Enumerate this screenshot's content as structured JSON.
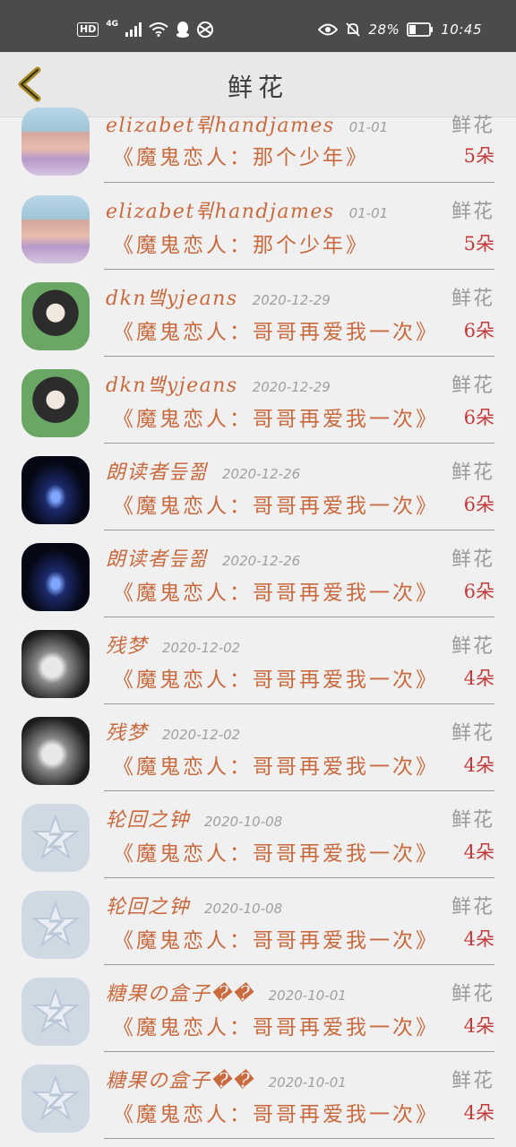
{
  "status_bar": {
    "hd": "HD",
    "network": "4G",
    "battery": "28%",
    "time": "10:45"
  },
  "header": {
    "title": "鲜花"
  },
  "rows": [
    {
      "name": "elizabet뤾handjames",
      "date": "01-01",
      "gift": "鲜花",
      "book": "《魔鬼恋人：那个少年》",
      "count": "5朵",
      "avatar": "boy"
    },
    {
      "name": "elizabet뤾handjames",
      "date": "01-01",
      "gift": "鲜花",
      "book": "《魔鬼恋人：那个少年》",
      "count": "5朵",
      "avatar": "boy"
    },
    {
      "name": "dkn뱈yjeans",
      "date": "2020-12-29",
      "gift": "鲜花",
      "book": "《魔鬼恋人：哥哥再爱我一次》",
      "count": "6朵",
      "avatar": "girl"
    },
    {
      "name": "dkn뱈yjeans",
      "date": "2020-12-29",
      "gift": "鲜花",
      "book": "《魔鬼恋人：哥哥再爱我一次》",
      "count": "6朵",
      "avatar": "girl"
    },
    {
      "name": "朗读者듶쬚",
      "date": "2020-12-26",
      "gift": "鲜花",
      "book": "《魔鬼恋人：哥哥再爱我一次》",
      "count": "6朵",
      "avatar": "tunnel"
    },
    {
      "name": "朗读者듶쬚",
      "date": "2020-12-26",
      "gift": "鲜花",
      "book": "《魔鬼恋人：哥哥再爱我一次》",
      "count": "6朵",
      "avatar": "tunnel"
    },
    {
      "name": "残梦",
      "date": "2020-12-02",
      "gift": "鲜花",
      "book": "《魔鬼恋人：哥哥再爱我一次》",
      "count": "4朵",
      "avatar": "sad"
    },
    {
      "name": "残梦",
      "date": "2020-12-02",
      "gift": "鲜花",
      "book": "《魔鬼恋人：哥哥再爱我一次》",
      "count": "4朵",
      "avatar": "sad"
    },
    {
      "name": "轮回之钟",
      "date": "2020-10-08",
      "gift": "鲜花",
      "book": "《魔鬼恋人：哥哥再爱我一次》",
      "count": "4朵",
      "avatar": "default"
    },
    {
      "name": "轮回之钟",
      "date": "2020-10-08",
      "gift": "鲜花",
      "book": "《魔鬼恋人：哥哥再爱我一次》",
      "count": "4朵",
      "avatar": "default"
    },
    {
      "name": "糖果の盒子��",
      "date": "2020-10-01",
      "gift": "鲜花",
      "book": "《魔鬼恋人：哥哥再爱我一次》",
      "count": "4朵",
      "avatar": "default"
    },
    {
      "name": "糖果の盒子��",
      "date": "2020-10-01",
      "gift": "鲜花",
      "book": "《魔鬼恋人：哥哥再爱我一次》",
      "count": "4朵",
      "avatar": "default"
    }
  ]
}
